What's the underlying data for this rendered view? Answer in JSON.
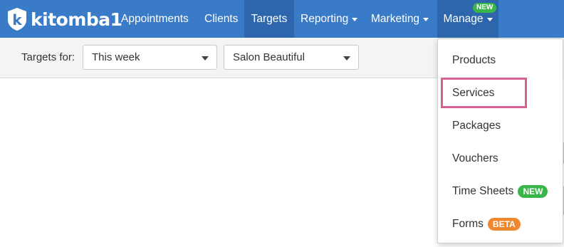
{
  "brand": {
    "name": "kitomba1",
    "logo_letter": "k"
  },
  "nav": {
    "items": [
      {
        "label": "Appointments",
        "dropdown": false
      },
      {
        "label": "Clients",
        "dropdown": false
      },
      {
        "label": "Targets",
        "dropdown": false,
        "active": true
      },
      {
        "label": "Reporting",
        "dropdown": true
      },
      {
        "label": "Marketing",
        "dropdown": true
      },
      {
        "label": "Manage",
        "dropdown": true,
        "badge": "NEW"
      }
    ]
  },
  "toolbar": {
    "targets_label": "Targets for:",
    "period_select": "This week",
    "location_select": "Salon Beautiful"
  },
  "manage_menu": {
    "items": [
      {
        "label": "Products"
      },
      {
        "label": "Services",
        "highlighted": true
      },
      {
        "label": "Packages"
      },
      {
        "label": "Vouchers"
      },
      {
        "label": "Time Sheets",
        "badge": "NEW"
      },
      {
        "label": "Forms",
        "badge": "BETA"
      }
    ]
  },
  "colors": {
    "navbar": "#3a7bc8",
    "active_nav": "#2d66ad",
    "badge_new": "#39b54a",
    "badge_beta": "#f0862e",
    "highlight": "#d6638f"
  }
}
